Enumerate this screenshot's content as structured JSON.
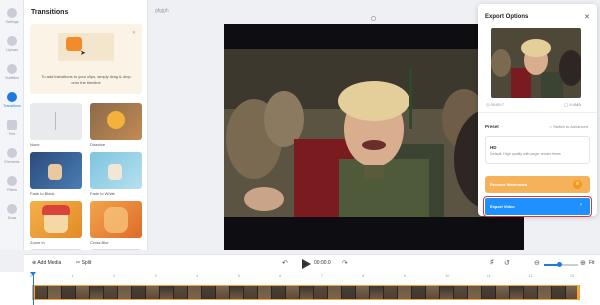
{
  "rail": [
    {
      "label": "Settings",
      "icon": "gear-icon"
    },
    {
      "label": "Upload",
      "icon": "upload-icon"
    },
    {
      "label": "Subtitles",
      "icon": "subtitle-icon"
    },
    {
      "label": "Transitions",
      "icon": "transitions-icon",
      "active": true
    },
    {
      "label": "Text",
      "icon": "text-icon"
    },
    {
      "label": "Elements",
      "icon": "elements-icon"
    },
    {
      "label": "Filters",
      "icon": "filters-icon"
    },
    {
      "label": "Draw",
      "icon": "draw-icon"
    }
  ],
  "panel": {
    "title": "Transitions",
    "hint": "To add transitions to your clips, simply drag & drop onto the timeline",
    "items": [
      {
        "label": "None"
      },
      {
        "label": "Dissolve"
      },
      {
        "label": "Fade to Black"
      },
      {
        "label": "Fade to White"
      },
      {
        "label": "Zoom In"
      },
      {
        "label": "Cross Blur"
      }
    ]
  },
  "project": {
    "name": "gfgjgh"
  },
  "export": {
    "title": "Export Options",
    "duration": "00:09.7",
    "size": "6.4MB",
    "preset_label": "Preset",
    "switch_label": "< Switch to Advanced",
    "preset_name": "HD",
    "preset_desc": "Default. High quality with larger render times",
    "remove_watermark": "Remove Watermark",
    "export_video": "Export Video"
  },
  "toolbar": {
    "add_media": "Add Media",
    "split": "Split",
    "timecode": "00:00.0",
    "zoom_percent": "Fit",
    "zoom_level": 0.45
  },
  "timeline": {
    "ticks": [
      "0",
      "1",
      "2",
      "3",
      "4",
      "5",
      "6",
      "7",
      "8",
      "9",
      "10",
      "11",
      "12",
      "13"
    ]
  },
  "colors": {
    "accent": "#1f7ae0",
    "export_button": "#1e90ff",
    "watermark_button": "#f6b25a",
    "highlight_border": "#d9363e"
  }
}
